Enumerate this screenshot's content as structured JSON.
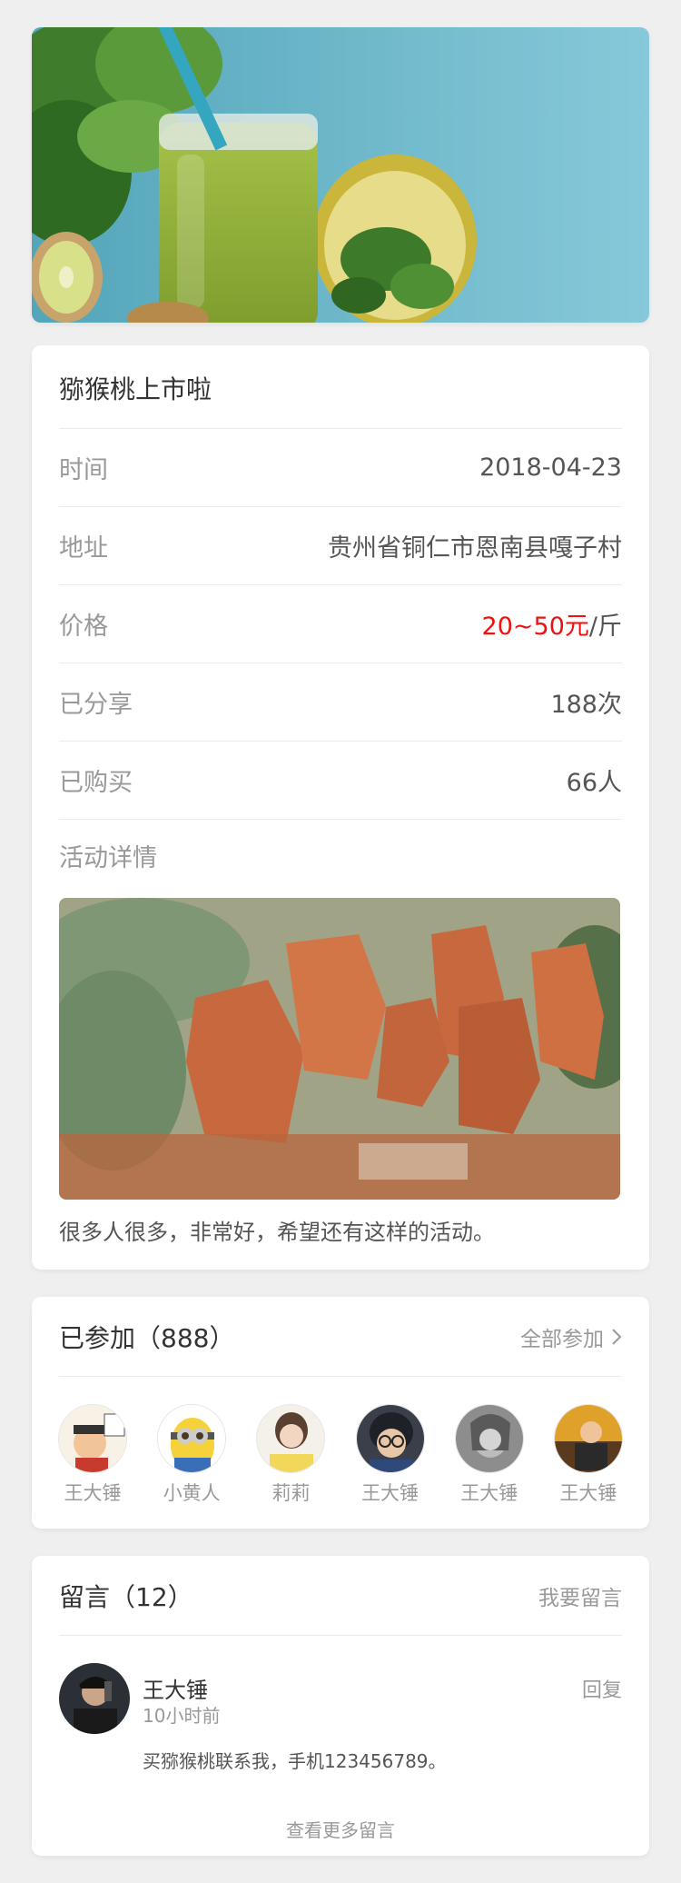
{
  "event": {
    "title": "猕猴桃上市啦",
    "rows": [
      {
        "label": "时间",
        "value": "2018-04-23"
      },
      {
        "label": "地址",
        "value": "贵州省铜仁市恩南县嘎子村"
      },
      {
        "label": "价格",
        "price": "20~50元",
        "unit": "/斤"
      },
      {
        "label": "已分享",
        "value": "188次"
      },
      {
        "label": "已购买",
        "value": "66人"
      }
    ],
    "detail_label": "活动详情",
    "detail_text": "很多人很多，非常好，希望还有这样的活动。"
  },
  "joined": {
    "title": "已参加（888）",
    "link": "全部参加",
    "members": [
      {
        "name": "王大锤"
      },
      {
        "name": "小黄人"
      },
      {
        "name": "莉莉"
      },
      {
        "name": "王大锤"
      },
      {
        "name": "王大锤"
      },
      {
        "name": "王大锤"
      }
    ]
  },
  "comments": {
    "title": "留言（12）",
    "link": "我要留言",
    "items": [
      {
        "name": "王大锤",
        "time": "10小时前",
        "reply": "回复",
        "text": "买猕猴桃联系我，手机123456789。"
      }
    ],
    "more": "查看更多留言"
  },
  "colors": {
    "background": "#efefef",
    "price": "#ee1111",
    "muted": "#999999",
    "text": "#333333"
  },
  "images": {
    "hero": "kiwi-smoothie-photo",
    "detail": "bagged-kiwi-orchard-photo"
  }
}
